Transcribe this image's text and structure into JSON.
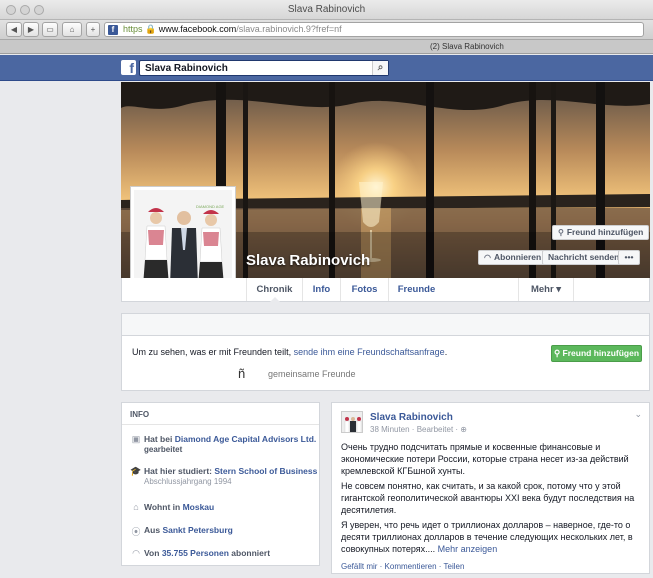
{
  "window": {
    "title": "Slava Rabinovich"
  },
  "browser": {
    "url_scheme": "https",
    "url_domain": "www.facebook.com",
    "url_path": "/slava.rabinovich.9?fref=nf",
    "tab_label": "(2) Slava Rabinovich"
  },
  "search": {
    "value": "Slava Rabinovich"
  },
  "profile": {
    "name": "Slava Rabinovich",
    "add_friend_label": "Freund hinzufügen",
    "subscribe_label": "Abonnieren",
    "message_label": "Nachricht senden",
    "more_label": "•••"
  },
  "nav": {
    "tabs": [
      {
        "label": "Chronik"
      },
      {
        "label": "Info"
      },
      {
        "label": "Fotos"
      },
      {
        "label": "Freunde"
      },
      {
        "label": "Mehr ▾"
      }
    ]
  },
  "friend_request": {
    "text_before": "Um zu sehen, was er mit Freunden teilt,",
    "link_text": "sende ihm eine Freundschaftsanfrage",
    "text_after": ".",
    "button_label": "Freund hinzufügen",
    "mutual_label": "gemeinsame Freunde"
  },
  "info": {
    "heading": "INFO",
    "rows": [
      {
        "icon": "briefcase-icon",
        "prefix": "Hat bei",
        "link": "Diamond Age Capital Advisors Ltd.",
        "line2": "gearbeitet"
      },
      {
        "icon": "graduation-icon",
        "prefix": "Hat hier studiert:",
        "link": "Stern School of Business",
        "sub": "Abschlussjahrgang 1994"
      },
      {
        "icon": "house-icon",
        "prefix": "Wohnt in",
        "link": "Moskau"
      },
      {
        "icon": "location-pin-icon",
        "prefix": "Aus",
        "link": "Sankt Petersburg"
      },
      {
        "icon": "rss-icon",
        "prefix": "Von",
        "link": "35.755 Personen",
        "suffix": "abonniert"
      }
    ]
  },
  "post": {
    "author": "Slava Rabinovich",
    "meta": "38 Minuten · Bearbeitet · ⊕",
    "p1": "Очень трудно подсчитать прямые и косвенные финансовые и экономические потери России, которые страна несет из-за действий кремлевской КГБшной хунты.",
    "p2": "Не совсем понятно, как считать, и за какой срок, потому что у этой гигантской геополитической авантюры XXI века будут последствия на десятилетия.",
    "p3": "Я уверен, что речь идет о триллионах долларов – наверное, где-то о десяти триллионах долларов в течение следующих нескольких лет, в совокупных потерях....",
    "more_label": "Mehr anzeigen",
    "actions": "Gefällt mir · Kommentieren · Teilen"
  },
  "colors": {
    "facebook_blue": "#4b67a1",
    "link": "#3b5998",
    "green_button": "#5cb85c"
  }
}
